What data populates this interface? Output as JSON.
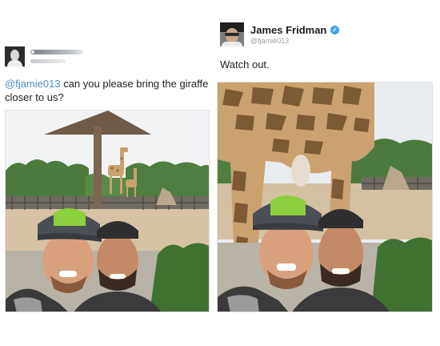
{
  "left_tweet": {
    "reply_mention": "@fjamie013",
    "reply_text": " can you please bring the giraffe closer to us?",
    "photo": "selfie-with-distant-giraffes"
  },
  "right_tweet": {
    "display_name": "James Fridman",
    "handle": "@fjamie013",
    "verified_icon": "verified-badge-icon",
    "text": "Watch out.",
    "photo": "selfie-with-giraffe-behind"
  },
  "colors": {
    "mention": "#4a8fc9",
    "verified": "#3ea3e8",
    "handle": "#98a1a9"
  }
}
